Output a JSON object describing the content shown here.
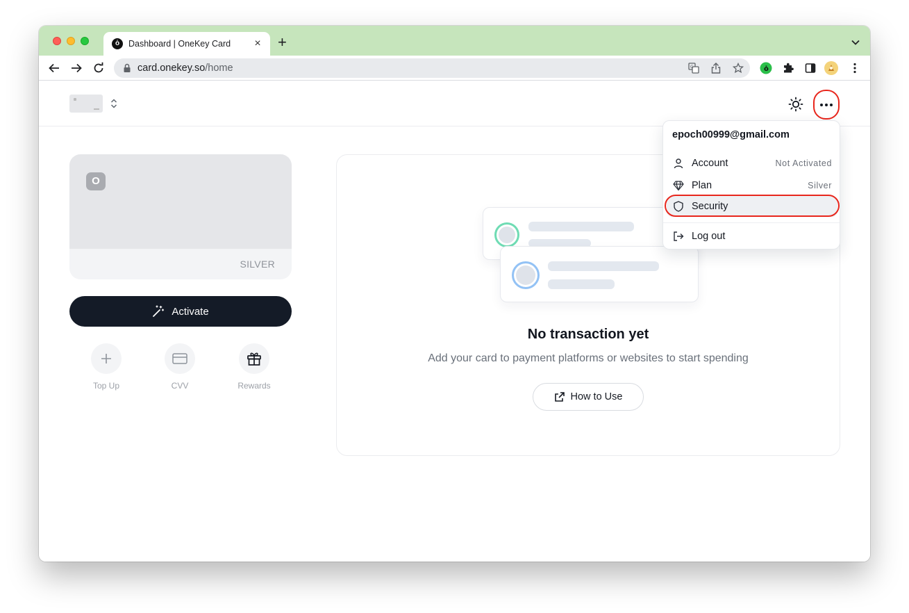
{
  "browser": {
    "tab_title": "Dashboard | OneKey Card",
    "tab_favicon": "onekey-logo-icon",
    "tab_close": "×",
    "new_tab": "+",
    "url_host": "card.onekey.so",
    "url_path": "/home"
  },
  "header": {
    "card_switch_icon": "chevron-updown-icon",
    "theme_icon": "sun-icon",
    "more_icon": "more-horizontal-icon"
  },
  "card": {
    "logo": "O",
    "tier": "SILVER"
  },
  "actions": {
    "activate_label": "Activate",
    "quick": [
      {
        "label": "Top Up",
        "icon": "plus-icon"
      },
      {
        "label": "CVV",
        "icon": "credit-card-icon"
      },
      {
        "label": "Rewards",
        "icon": "gift-icon"
      }
    ]
  },
  "transactions": {
    "empty_title": "No transaction yet",
    "empty_subtitle": "Add your card to payment platforms or websites to start spending",
    "how_to_label": "How to Use"
  },
  "menu": {
    "email": "epoch00999@gmail.com",
    "items": [
      {
        "label": "Account",
        "value": "Not Activated",
        "icon": "user-icon"
      },
      {
        "label": "Plan",
        "value": "Silver",
        "icon": "diamond-icon"
      },
      {
        "label": "Security",
        "value": "",
        "icon": "shield-icon"
      },
      {
        "label": "Log out",
        "value": "",
        "icon": "logout-icon"
      }
    ]
  },
  "colors": {
    "tab_strip": "#c6e5bc",
    "primary_button": "#141b27",
    "highlight": "#e8261c",
    "ring_green": "#6fdcb4",
    "ring_blue": "#93c2f5"
  }
}
